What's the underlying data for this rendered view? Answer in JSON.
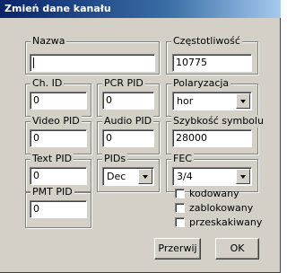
{
  "window": {
    "title": "Zmień dane kanału"
  },
  "fields": {
    "nazwa": {
      "label": "Nazwa",
      "value": ""
    },
    "czestotliwosc": {
      "label": "Częstotliwość",
      "value": "10775"
    },
    "ch_id": {
      "label": "Ch. ID",
      "value": "0"
    },
    "pcr_pid": {
      "label": "PCR PID",
      "value": "0"
    },
    "polaryzacja": {
      "label": "Polaryzacja",
      "value": "hor"
    },
    "video_pid": {
      "label": "Video PID",
      "value": "0"
    },
    "audio_pid": {
      "label": "Audio PID",
      "value": "0"
    },
    "szybkosc": {
      "label": "Szybkość symbolu",
      "value": "28000"
    },
    "text_pid": {
      "label": "Text PID",
      "value": "0"
    },
    "pids": {
      "label": "PIDs",
      "value": "Dec"
    },
    "fec": {
      "label": "FEC",
      "value": "3/4"
    },
    "pmt_pid": {
      "label": "PMT PID",
      "value": "0"
    }
  },
  "checkboxes": {
    "kodowany": {
      "label": "kodowany",
      "checked": false
    },
    "zablokowany": {
      "label": "zablokowany",
      "checked": false
    },
    "przeskakiwany": {
      "label": "przeskakiwany",
      "checked": false
    }
  },
  "buttons": {
    "cancel": "Przerwij",
    "ok": "OK"
  }
}
